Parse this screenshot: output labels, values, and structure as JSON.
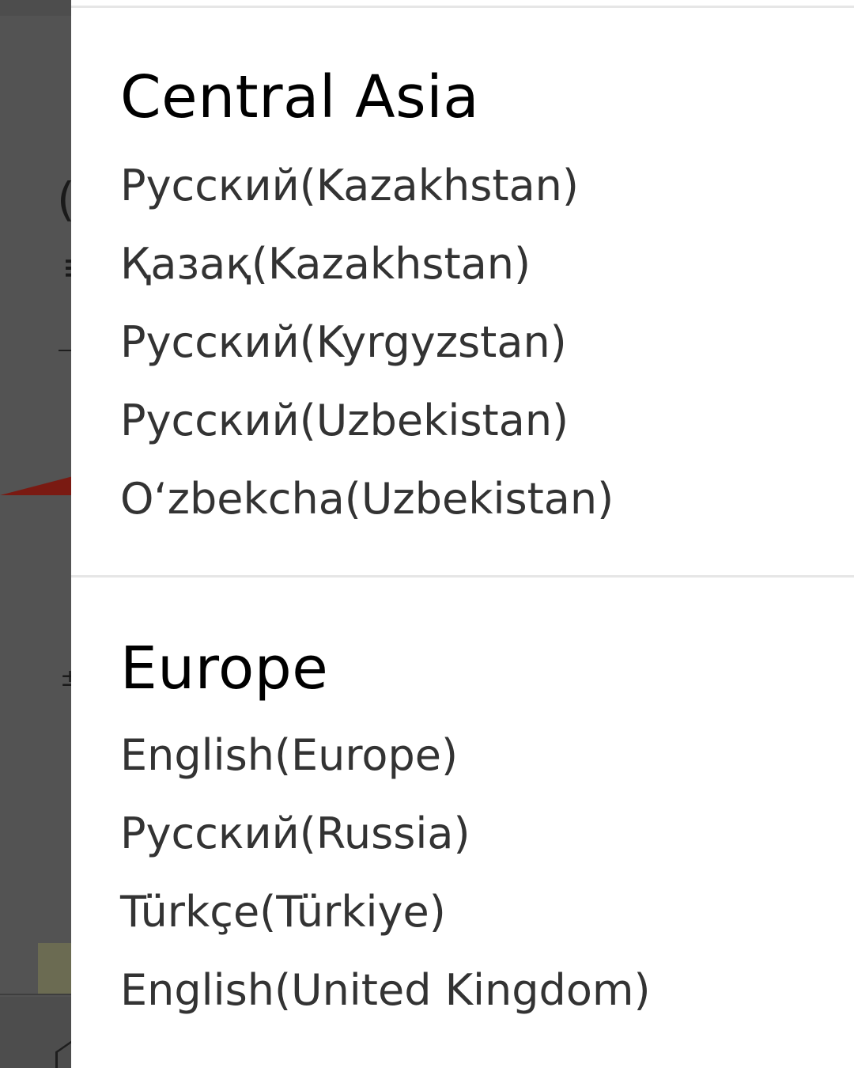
{
  "sections": [
    {
      "title": "Central Asia",
      "items": [
        "Русский(Kazakhstan)",
        "Қазақ(Kazakhstan)",
        "Русский(Kyrgyzstan)",
        "Русский(Uzbekistan)",
        "O‘zbekcha(Uzbekistan)"
      ]
    },
    {
      "title": "Europe",
      "items": [
        "English(Europe)",
        "Русский(Russia)",
        "Türkçe(Türkiye)",
        "English(United Kingdom)"
      ]
    }
  ],
  "colors": {
    "overlay": "#4d4d4d",
    "panel": "#ffffff",
    "heading": "#000000",
    "item_text": "#333333",
    "divider": "#e6e6e6",
    "accent_stripe": "#7a1a12"
  }
}
